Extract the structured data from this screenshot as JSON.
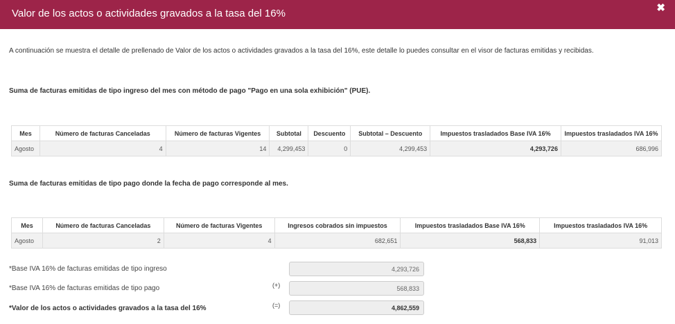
{
  "header": {
    "title": "Valor de los actos o actividades gravados a la tasa del 16%",
    "close_icon": "close-icon"
  },
  "intro": "A continuación se muestra el detalle de prellenado de Valor de los actos o actividades gravados a la tasa del 16%, este detalle lo puedes consultar en el visor de facturas emitidas y recibidas.",
  "section1": {
    "title": "Suma de facturas emitidas de tipo ingreso del mes con método de pago \"Pago en una sola exhibición\" (PUE).",
    "headers": [
      "Mes",
      "Número de facturas Canceladas",
      "Número de facturas Vigentes",
      "Subtotal",
      "Descuento",
      "Subtotal – Descuento",
      "Impuestos trasladados Base IVA 16%",
      "Impuestos trasladados IVA 16%"
    ],
    "row": [
      "Agosto",
      "4",
      "14",
      "4,299,453",
      "0",
      "4,299,453",
      "4,293,726",
      "686,996"
    ]
  },
  "section2": {
    "title": "Suma de facturas emitidas de tipo pago donde la fecha de pago corresponde al mes.",
    "headers": [
      "Mes",
      "Número de facturas Canceladas",
      "Número de facturas Vigentes",
      "Ingresos cobrados sin impuestos",
      "Impuestos trasladados Base IVA 16%",
      "Impuestos trasladados IVA 16%"
    ],
    "row": [
      "Agosto",
      "2",
      "4",
      "682,651",
      "568,833",
      "91,013"
    ]
  },
  "summary": {
    "line1": {
      "label": "*Base IVA 16% de facturas emitidas de tipo ingreso",
      "op": "",
      "value": "4,293,726"
    },
    "line2": {
      "label": "*Base IVA 16% de facturas emitidas de tipo pago",
      "op": "(+)",
      "value": "568,833"
    },
    "line3": {
      "label": "*Valor de los actos o actividades gravados a la tasa del 16%",
      "op": "(=)",
      "value": "4,862,559"
    }
  },
  "colors": {
    "header_bg": "#9d2449",
    "header_text": "#ffffff"
  }
}
